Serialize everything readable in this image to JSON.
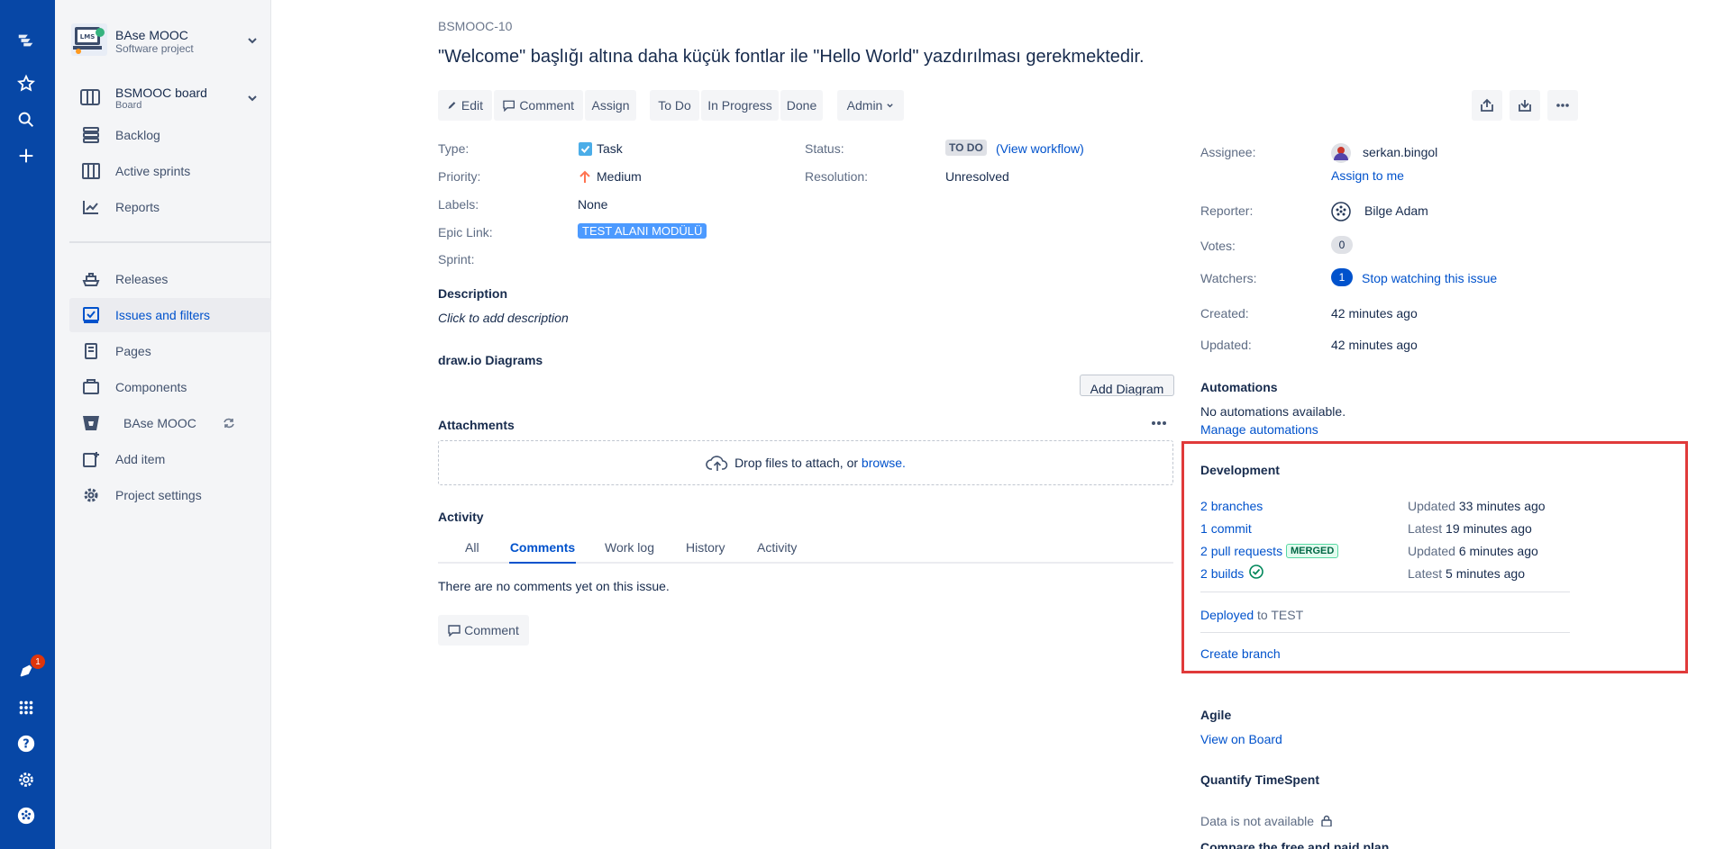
{
  "sidebar": {
    "project_name": "BAse MOOC",
    "project_type": "Software project",
    "board_name": "BSMOOC board",
    "board_type": "Board",
    "items": [
      {
        "label": "Backlog",
        "icon": "backlog-icon"
      },
      {
        "label": "Active sprints",
        "icon": "board-columns-icon"
      },
      {
        "label": "Reports",
        "icon": "chart-icon"
      },
      {
        "label": "Releases",
        "icon": "ship-icon"
      },
      {
        "label": "Issues and filters",
        "icon": "issues-icon"
      },
      {
        "label": "Pages",
        "icon": "page-icon"
      },
      {
        "label": "Components",
        "icon": "component-icon"
      },
      {
        "label": "BAse MOOC",
        "icon": "bitbucket-icon"
      },
      {
        "label": "Add item",
        "icon": "add-item-icon"
      },
      {
        "label": "Project settings",
        "icon": "gear-icon"
      }
    ]
  },
  "rail": {
    "notification_count": "1"
  },
  "issue": {
    "key": "BSMOOC-10",
    "title": "\"Welcome\" başlığı altına daha küçük fontlar ile \"Hello World\" yazdırılması gerekmektedir."
  },
  "toolbar": {
    "edit": "Edit",
    "comment": "Comment",
    "assign": "Assign",
    "todo": "To Do",
    "in_progress": "In Progress",
    "done": "Done",
    "admin": "Admin"
  },
  "details": {
    "type_label": "Type:",
    "type_value": "Task",
    "priority_label": "Priority:",
    "priority_value": "Medium",
    "labels_label": "Labels:",
    "labels_value": "None",
    "epic_label": "Epic Link:",
    "epic_value": "TEST ALANI MODÜLÜ",
    "sprint_label": "Sprint:",
    "status_label": "Status:",
    "status_value": "TO DO",
    "view_workflow": "(View workflow)",
    "resolution_label": "Resolution:",
    "resolution_value": "Unresolved"
  },
  "description": {
    "title": "Description",
    "placeholder": "Click to add description"
  },
  "drawio": {
    "title": "draw.io Diagrams",
    "add_button": "Add Diagram"
  },
  "attachments": {
    "title": "Attachments",
    "drop_text": "Drop files to attach, or ",
    "browse": "browse."
  },
  "activity": {
    "title": "Activity",
    "tabs": [
      "All",
      "Comments",
      "Work log",
      "History",
      "Activity"
    ],
    "active_tab": "Comments",
    "empty": "There are no comments yet on this issue.",
    "comment_button": "Comment"
  },
  "people": {
    "assignee_label": "Assignee:",
    "assignee": "serkan.bingol",
    "assign_to_me": "Assign to me",
    "reporter_label": "Reporter:",
    "reporter": "Bilge Adam",
    "votes_label": "Votes:",
    "votes": "0",
    "watchers_label": "Watchers:",
    "watchers": "1",
    "stop_watching": "Stop watching this issue"
  },
  "dates": {
    "created_label": "Created:",
    "created": "42 minutes ago",
    "updated_label": "Updated:",
    "updated": "42 minutes ago"
  },
  "automations": {
    "title": "Automations",
    "none": "No automations available.",
    "manage": "Manage automations"
  },
  "development": {
    "title": "Development",
    "rows": [
      {
        "count": "2",
        "label": "branches",
        "status": "Updated",
        "time": "33 minutes ago"
      },
      {
        "count": "1",
        "label": "commit",
        "status": "Latest",
        "time": "19 minutes ago"
      },
      {
        "count": "2",
        "label": "pull requests",
        "status": "Updated",
        "time": "6 minutes ago"
      },
      {
        "count": "2",
        "label": "builds",
        "status": "Latest",
        "time": "5 minutes ago"
      }
    ],
    "merged": "MERGED",
    "deployed": "Deployed",
    "deployed_to": "to TEST",
    "create_branch": "Create branch",
    "accent": "#e03a3a"
  },
  "agile": {
    "title": "Agile",
    "view_on_board": "View on Board"
  },
  "timespent": {
    "title": "Quantify TimeSpent",
    "not_available": "Data is not available",
    "compare": "Compare the free and paid plan"
  }
}
